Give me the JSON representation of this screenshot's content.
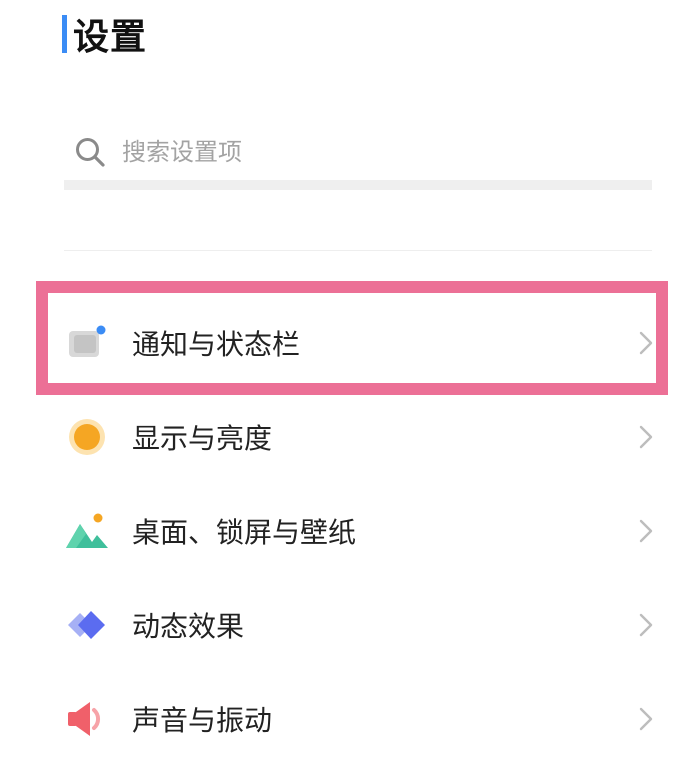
{
  "header": {
    "title": "设置"
  },
  "search": {
    "placeholder": "搜索设置项"
  },
  "items": [
    {
      "label": "通知与状态栏",
      "icon": "notification-status-bar-icon"
    },
    {
      "label": "显示与亮度",
      "icon": "display-brightness-icon"
    },
    {
      "label": "桌面、锁屏与壁纸",
      "icon": "desktop-wallpaper-icon"
    },
    {
      "label": "动态效果",
      "icon": "animation-effects-icon"
    },
    {
      "label": "声音与振动",
      "icon": "sound-vibration-icon"
    }
  ],
  "colors": {
    "accent": "#3b8cf5",
    "highlight": "#ec7096",
    "display_icon": "#f5a623",
    "wallpaper_icon": "#3fbf9b",
    "animation_icon": "#5b6cf0",
    "sound_icon": "#f0606a"
  }
}
